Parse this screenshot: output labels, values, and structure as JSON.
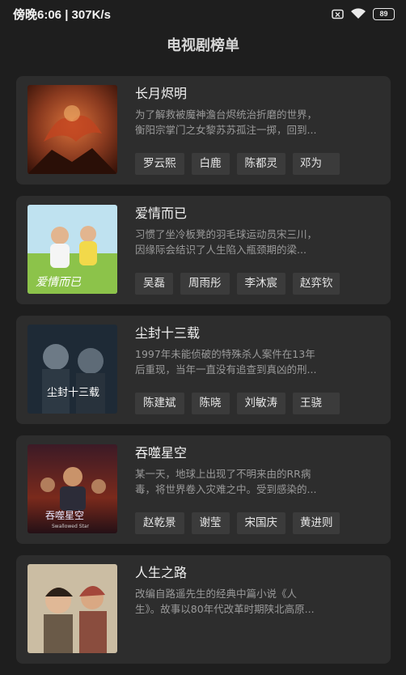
{
  "status_bar": {
    "time": "傍晚6:06 | 307K/s",
    "battery": "89"
  },
  "header": {
    "title": "电视剧榜单"
  },
  "shows": [
    {
      "title": "长月烬明",
      "desc1": "为了解救被魔神澹台烬统治折磨的世界，",
      "desc2": "衡阳宗掌门之女黎苏苏孤注一掷，回到...",
      "cast": [
        "罗云熙",
        "白鹿",
        "陈都灵",
        "邓为"
      ],
      "poster_color": "#8a3a1f"
    },
    {
      "title": "爱情而已",
      "desc1": "习惯了坐冷板凳的羽毛球运动员宋三川，",
      "desc2": "因缘际会结识了人生陷入瓶颈期的梁...",
      "cast": [
        "吴磊",
        "周雨彤",
        "李沐宸",
        "赵弈钦"
      ],
      "poster_color": "#7fbf4a",
      "poster_caption": "爱情而已"
    },
    {
      "title": "尘封十三载",
      "desc1": "1997年未能侦破的特殊杀人案件在13年",
      "desc2": "后重现，当年一直没有追查到真凶的刑...",
      "cast": [
        "陈建斌",
        "陈晓",
        "刘敏涛",
        "王骁"
      ],
      "poster_color": "#1e2a36",
      "poster_caption": "尘封十三载"
    },
    {
      "title": "吞噬星空",
      "desc1": "某一天，地球上出现了不明来由的RR病",
      "desc2": "毒，将世界卷入灾难之中。受到感染的...",
      "cast": [
        "赵乾景",
        "谢莹",
        "宋国庆",
        "黄进则"
      ],
      "poster_color": "#7a2a1c",
      "poster_caption": "吞噬星空",
      "poster_subcaption": "Swallowed Star"
    },
    {
      "title": "人生之路",
      "desc1": "改编自路遥先生的经典中篇小说《人",
      "desc2": "生》。故事以80年代改革时期陕北高原...",
      "cast": [],
      "poster_color": "#b9a88e"
    }
  ]
}
